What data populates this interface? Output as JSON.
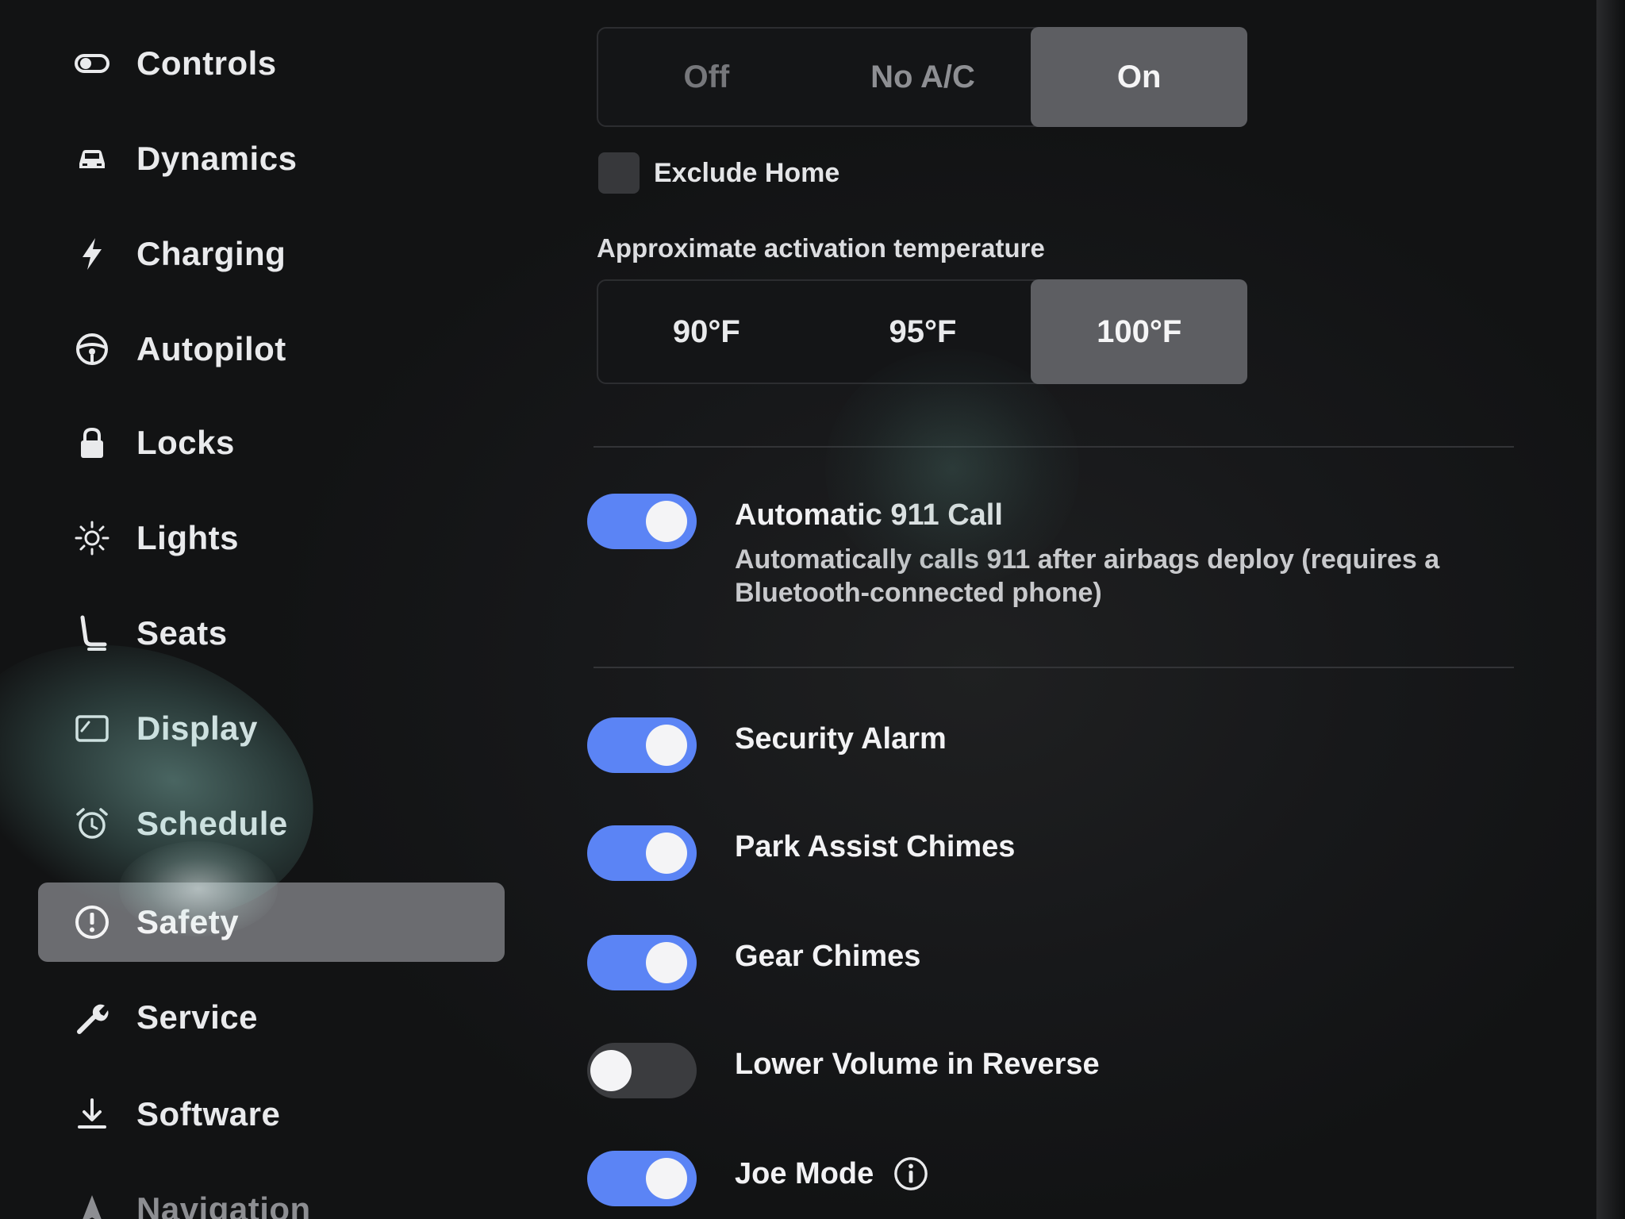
{
  "sidebar": {
    "items": [
      {
        "label": "Controls",
        "icon": "toggle-icon"
      },
      {
        "label": "Dynamics",
        "icon": "car-icon"
      },
      {
        "label": "Charging",
        "icon": "lightning-icon"
      },
      {
        "label": "Autopilot",
        "icon": "steering-wheel-icon"
      },
      {
        "label": "Locks",
        "icon": "lock-icon"
      },
      {
        "label": "Lights",
        "icon": "sun-icon"
      },
      {
        "label": "Seats",
        "icon": "seat-icon"
      },
      {
        "label": "Display",
        "icon": "display-icon"
      },
      {
        "label": "Schedule",
        "icon": "alarm-clock-icon"
      },
      {
        "label": "Safety",
        "icon": "exclamation-circle-icon",
        "active": true
      },
      {
        "label": "Service",
        "icon": "wrench-icon"
      },
      {
        "label": "Software",
        "icon": "download-icon"
      },
      {
        "label": "Navigation",
        "icon": "navigation-arrow-icon"
      }
    ]
  },
  "main": {
    "cabin_overheat": {
      "options": [
        "Off",
        "No A/C",
        "On"
      ],
      "selected": "On"
    },
    "exclude_home": {
      "label": "Exclude Home",
      "checked": false
    },
    "activation_temperature": {
      "label": "Approximate activation temperature",
      "options": [
        "90°F",
        "95°F",
        "100°F"
      ],
      "selected": "100°F"
    },
    "toggles": [
      {
        "title": "Automatic 911 Call",
        "description": "Automatically calls 911 after airbags deploy (requires a Bluetooth-connected phone)",
        "on": true
      },
      {
        "title": "Security Alarm",
        "on": true
      },
      {
        "title": "Park Assist Chimes",
        "on": true
      },
      {
        "title": "Gear Chimes",
        "on": true
      },
      {
        "title": "Lower Volume in Reverse",
        "on": false
      },
      {
        "title": "Joe Mode",
        "on": true,
        "info_icon": "info-icon"
      }
    ]
  },
  "colors": {
    "background": "#151618",
    "accent_toggle": "#5b84f5",
    "selected_segment": "#5d5e62",
    "active_nav": "#6b6c70"
  }
}
